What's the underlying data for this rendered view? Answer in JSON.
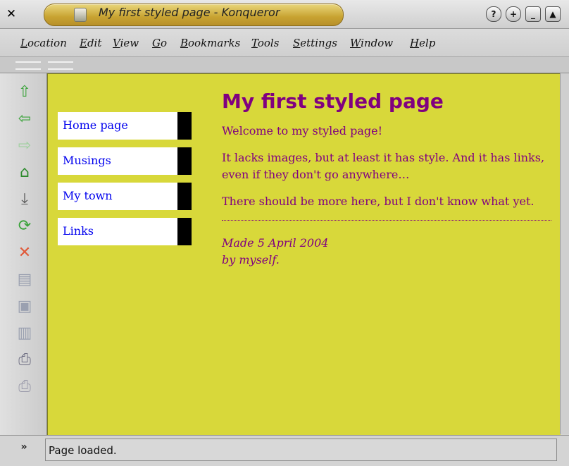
{
  "window": {
    "title": "My first styled page - Konqueror",
    "buttons": [
      "?",
      "+",
      "_",
      "▲"
    ]
  },
  "menu": [
    "Location",
    "Edit",
    "View",
    "Go",
    "Bookmarks",
    "Tools",
    "Settings",
    "Window",
    "Help"
  ],
  "toolbar": {
    "icons": [
      {
        "name": "up-arrow-icon",
        "glyph": "⇧",
        "color": "#3aa33a"
      },
      {
        "name": "back-arrow-icon",
        "glyph": "⇦",
        "color": "#3aa33a"
      },
      {
        "name": "forward-arrow-icon",
        "glyph": "⇨",
        "color": "#9ccf9c"
      },
      {
        "name": "home-icon",
        "glyph": "⌂",
        "color": "#2c8a2c"
      },
      {
        "name": "download-icon",
        "glyph": "⤓",
        "color": "#555555"
      },
      {
        "name": "reload-icon",
        "glyph": "⟳",
        "color": "#3aa33a"
      },
      {
        "name": "stop-icon",
        "glyph": "✕",
        "color": "#e05a3a"
      },
      {
        "name": "cut-icon",
        "glyph": "▤",
        "color": "#9aa0b0"
      },
      {
        "name": "copy-icon",
        "glyph": "▣",
        "color": "#9aa0b0"
      },
      {
        "name": "paste-icon",
        "glyph": "▥",
        "color": "#9aa0b0"
      },
      {
        "name": "print-icon",
        "glyph": "⎙",
        "color": "#6b6b80"
      },
      {
        "name": "print-preview-icon",
        "glyph": "⎙",
        "color": "#9a9aaa"
      }
    ],
    "more": "»"
  },
  "page": {
    "background": "#d8d83a",
    "nav": [
      "Home page",
      "Musings",
      "My town",
      "Links"
    ],
    "heading": "My first styled page",
    "paragraphs": [
      "Welcome to my styled page!",
      "It lacks images, but at least it has style. And it has links, even if they don't go anywhere…",
      "There should be more here, but I don't know what yet."
    ],
    "address": {
      "line1": "Made 5 April 2004",
      "line2": "by myself."
    }
  },
  "status": "Page loaded."
}
